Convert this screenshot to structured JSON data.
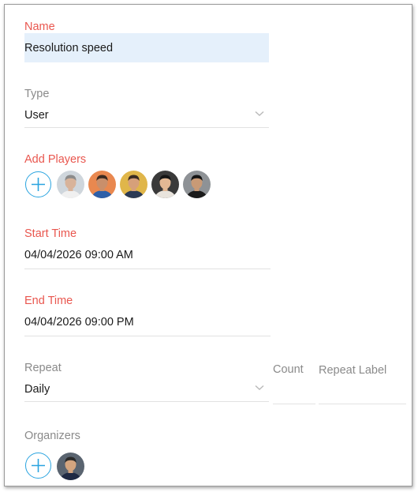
{
  "form": {
    "name": {
      "label": "Name",
      "value": "Resolution speed"
    },
    "type": {
      "label": "Type",
      "value": "User"
    },
    "players": {
      "label": "Add Players",
      "avatars": [
        {
          "bg": "#cfd6dc",
          "skin": "#d8b39a",
          "hair": "#8b8b8b",
          "shirt": "#f0f0f0"
        },
        {
          "bg": "#e9884f",
          "skin": "#c98f6b",
          "hair": "#3b2a20",
          "shirt": "#2d5fa8"
        },
        {
          "bg": "#e0b64a",
          "skin": "#d6a07a",
          "hair": "#3a2b22",
          "shirt": "#2b3a55"
        },
        {
          "bg": "#3a3a3a",
          "skin": "#e2b894",
          "hair": "#151515",
          "shirt": "#e9e4dd"
        },
        {
          "bg": "#8e9296",
          "skin": "#c99a76",
          "hair": "#141414",
          "shirt": "#1b1b1b"
        }
      ]
    },
    "start_time": {
      "label": "Start Time",
      "value": "04/04/2026 09:00 AM"
    },
    "end_time": {
      "label": "End Time",
      "value": "04/04/2026 09:00 PM"
    },
    "repeat": {
      "label": "Repeat",
      "value": "Daily"
    },
    "count": {
      "label": "Count",
      "value": ""
    },
    "repeat_label": {
      "label": "Repeat Label",
      "value": ""
    },
    "organizers": {
      "label": "Organizers",
      "avatars": [
        {
          "bg": "#5a6470",
          "skin": "#d4a57f",
          "hair": "#2a2a2a",
          "shirt": "#1f2a44"
        }
      ]
    }
  },
  "colors": {
    "required_label": "#e9574f",
    "optional_label": "#8a8a8a",
    "accent": "#2aa4e0",
    "input_highlight": "#e5f0fb"
  }
}
